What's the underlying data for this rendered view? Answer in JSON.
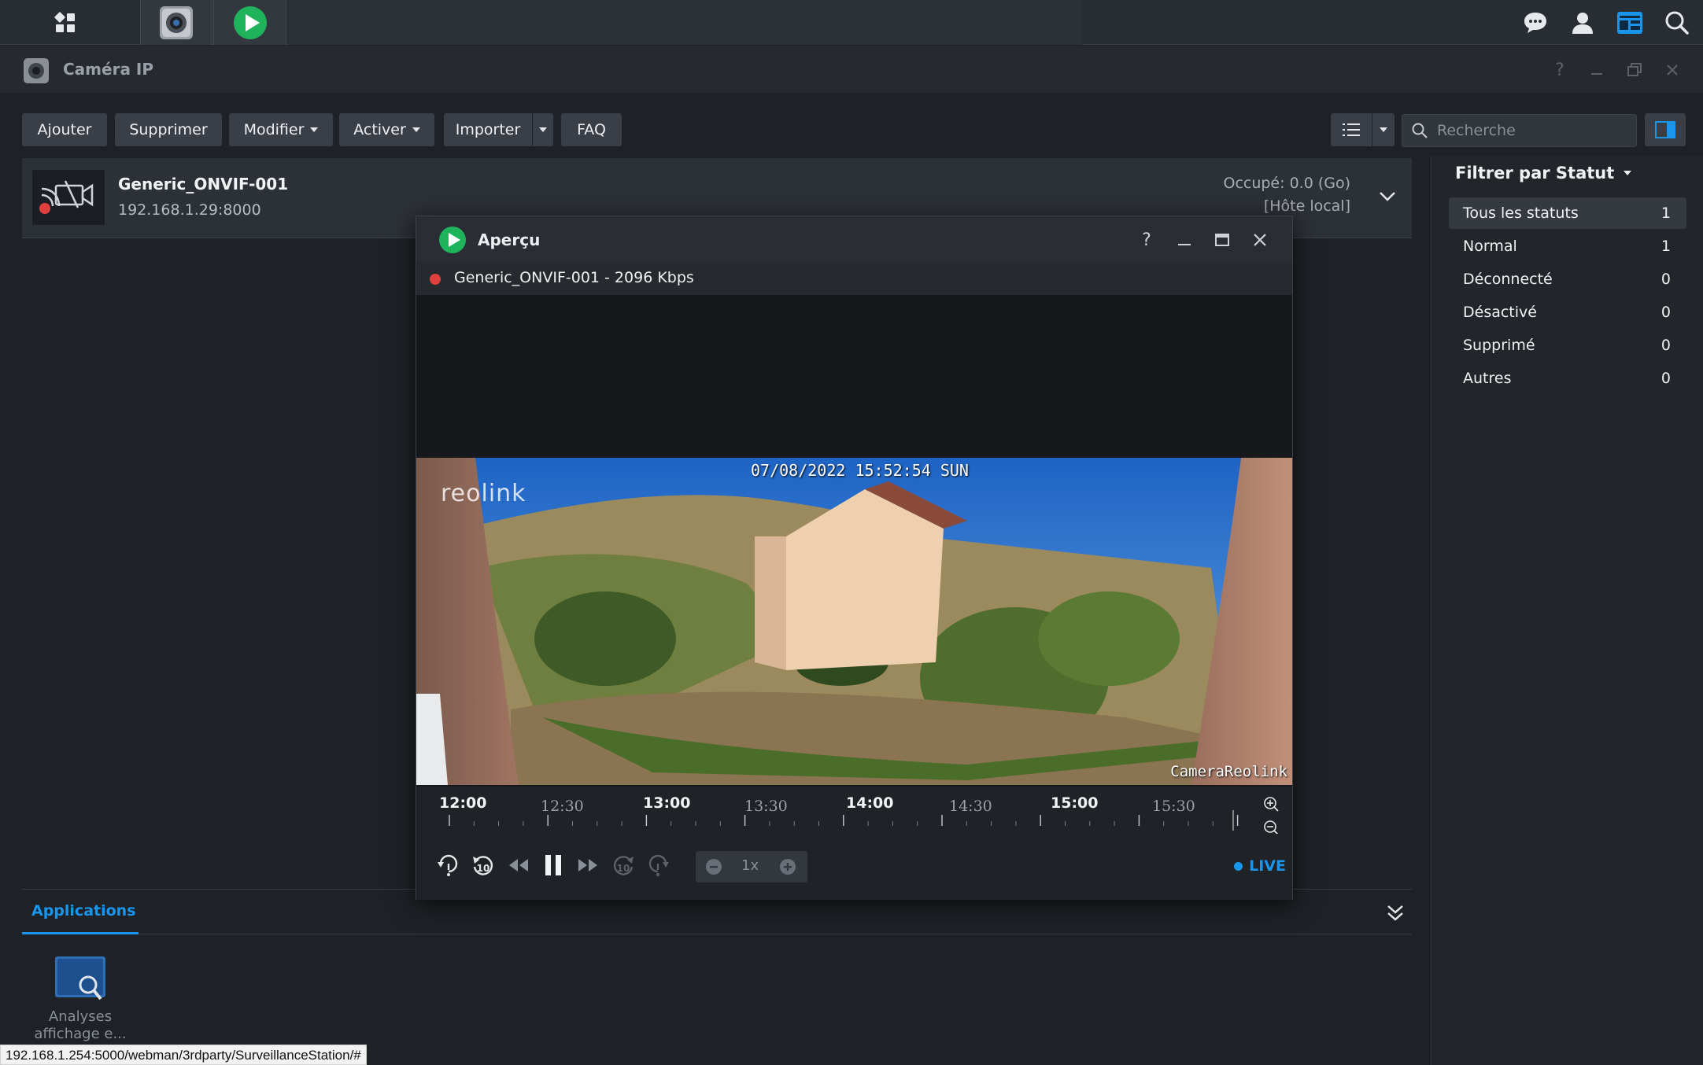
{
  "taskbar": {
    "apps": [
      "main-menu-icon",
      "camera-app-icon",
      "surveillance-play-icon"
    ],
    "right_icons": [
      "chat-icon",
      "user-icon",
      "widgets-icon",
      "search-icon"
    ]
  },
  "window": {
    "title": "Caméra IP",
    "controls": [
      "help-icon",
      "minimize-icon",
      "restore-icon",
      "close-icon"
    ]
  },
  "toolbar": {
    "add": "Ajouter",
    "delete": "Supprimer",
    "edit": "Modifier",
    "enable": "Activer",
    "import": "Importer",
    "faq": "FAQ",
    "search_placeholder": "Recherche"
  },
  "camera": {
    "name": "Generic_ONVIF-001",
    "address": "192.168.1.29:8000",
    "used": "Occupé: 0.0 (Go)",
    "host": "[Hôte local]"
  },
  "filter": {
    "title": "Filtrer par Statut",
    "items": [
      {
        "label": "Tous les statuts",
        "count": "1",
        "selected": true
      },
      {
        "label": "Normal",
        "count": "1"
      },
      {
        "label": "Déconnecté",
        "count": "0"
      },
      {
        "label": "Désactivé",
        "count": "0"
      },
      {
        "label": "Supprimé",
        "count": "0"
      },
      {
        "label": "Autres",
        "count": "0"
      }
    ]
  },
  "preview": {
    "title": "Aperçu",
    "stream": "Generic_ONVIF-001 - 2096 Kbps",
    "osd_time": "07/08/2022 15:52:54 SUN",
    "osd_logo": "reolink",
    "osd_name": "CameraReolink",
    "timeline_major": [
      "12:00",
      "13:00",
      "14:00",
      "15:00"
    ],
    "timeline_minor": [
      "12:30",
      "13:30",
      "14:30",
      "15:30"
    ],
    "speed": "1x",
    "live": "LIVE"
  },
  "apps": {
    "tab": "Applications",
    "tile_label_1": "Analyses",
    "tile_label_2": "affichage e..."
  },
  "statusbar": {
    "url": "192.168.1.254:5000/webman/3rdparty/SurveillanceStation/#"
  },
  "colors": {
    "accent": "#1a95ec",
    "record": "#e0403d",
    "play_green": "#1fb35b"
  }
}
